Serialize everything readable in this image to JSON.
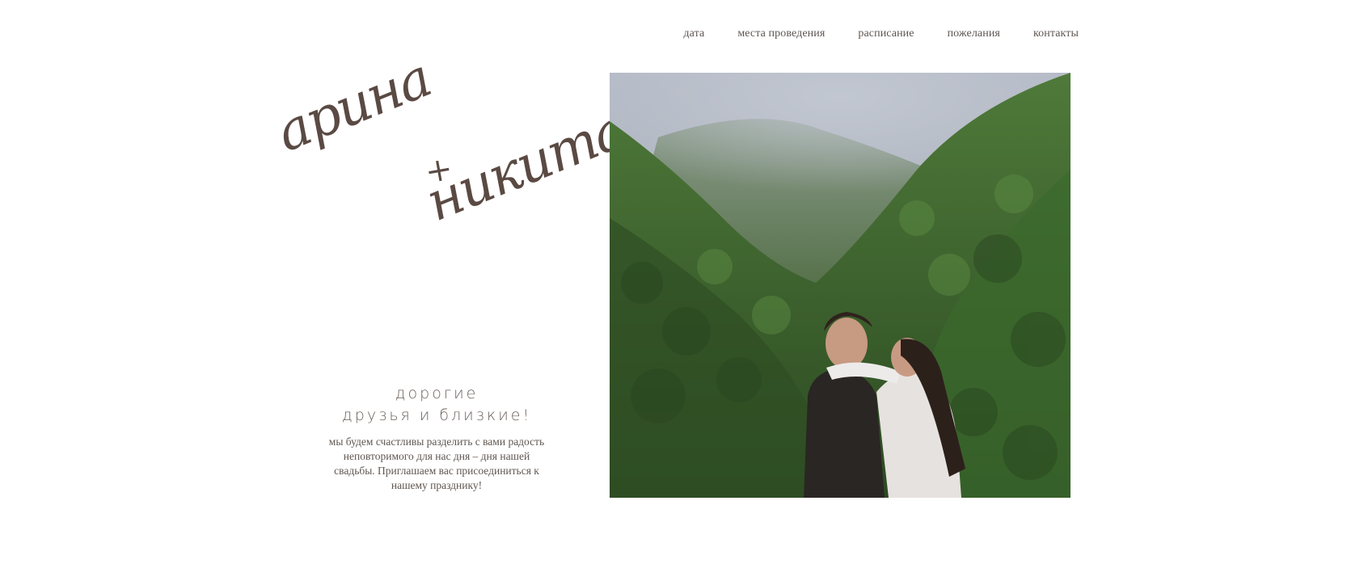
{
  "nav": {
    "items": [
      {
        "label": "дата"
      },
      {
        "label": "места проведения"
      },
      {
        "label": "расписание"
      },
      {
        "label": "пожелания"
      },
      {
        "label": "контакты"
      }
    ]
  },
  "hero": {
    "name_1": "арина",
    "plus": "+",
    "name_2": "никита",
    "greeting_line_1": "дорогие",
    "greeting_line_2": "друзья и близкие!",
    "message": "мы будем счастливы разделить с вами радость неповторимого для нас дня – дня нашей свадьбы. Приглашаем вас присоединиться к нашему празднику!"
  },
  "colors": {
    "text": "#5a4e47",
    "fog": "#b9bfca",
    "forest": "#3d5b2c"
  }
}
